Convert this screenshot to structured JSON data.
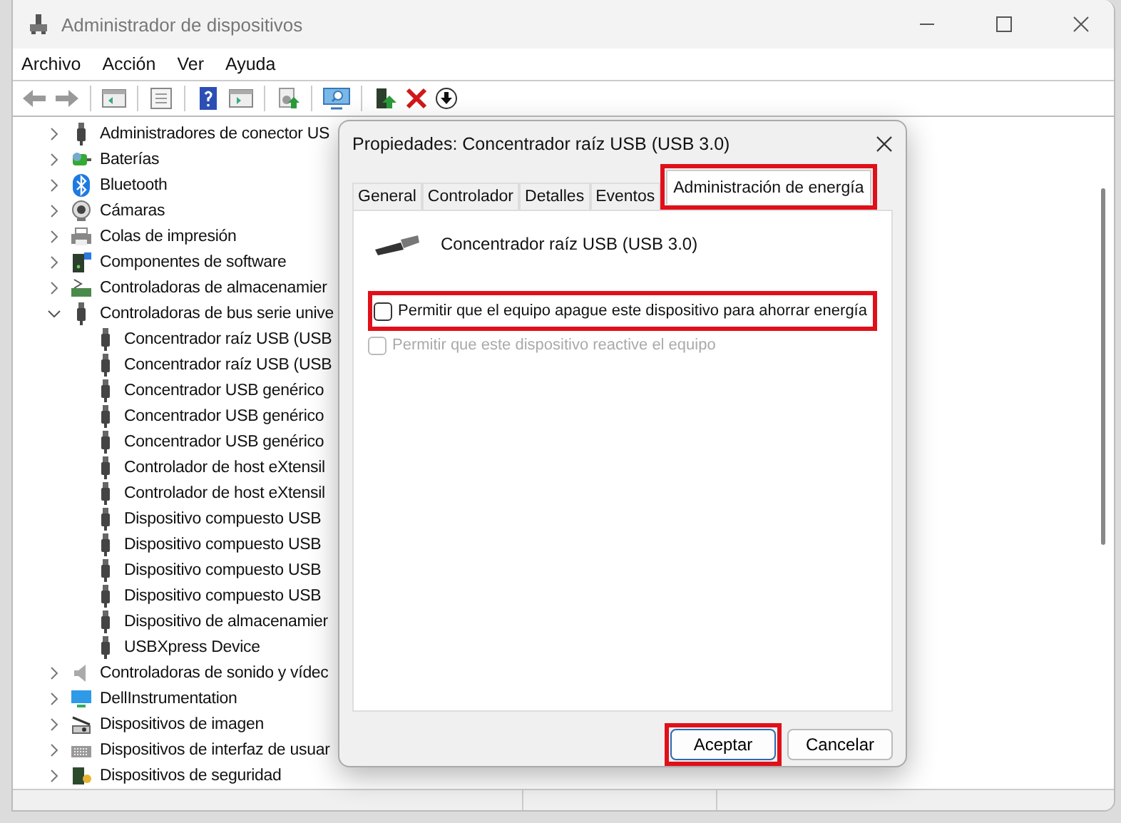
{
  "window": {
    "title": "Administrador de dispositivos"
  },
  "menu": [
    "Archivo",
    "Acción",
    "Ver",
    "Ayuda"
  ],
  "tree": [
    {
      "label": "Administradores de conector US",
      "expanded": false
    },
    {
      "label": "Baterías",
      "expanded": false
    },
    {
      "label": "Bluetooth",
      "expanded": false
    },
    {
      "label": "Cámaras",
      "expanded": false
    },
    {
      "label": "Colas de impresión",
      "expanded": false
    },
    {
      "label": "Componentes de software",
      "expanded": false
    },
    {
      "label": "Controladoras de almacenamier",
      "expanded": false
    },
    {
      "label": "Controladoras de bus serie unive",
      "expanded": true,
      "children": [
        {
          "label": "Concentrador raíz USB (USB"
        },
        {
          "label": "Concentrador raíz USB (USB"
        },
        {
          "label": "Concentrador USB genérico"
        },
        {
          "label": "Concentrador USB genérico"
        },
        {
          "label": "Concentrador USB genérico"
        },
        {
          "label": "Controlador de host eXtensil"
        },
        {
          "label": "Controlador de host eXtensil"
        },
        {
          "label": "Dispositivo compuesto USB"
        },
        {
          "label": "Dispositivo compuesto USB"
        },
        {
          "label": "Dispositivo compuesto USB"
        },
        {
          "label": "Dispositivo compuesto USB"
        },
        {
          "label": "Dispositivo de almacenamier"
        },
        {
          "label": "USBXpress Device"
        }
      ]
    },
    {
      "label": "Controladoras de sonido y vídec",
      "expanded": false
    },
    {
      "label": "DellInstrumentation",
      "expanded": false
    },
    {
      "label": "Dispositivos de imagen",
      "expanded": false
    },
    {
      "label": "Dispositivos de interfaz de usuar",
      "expanded": false
    },
    {
      "label": "Dispositivos de seguridad",
      "expanded": false
    }
  ],
  "dialog": {
    "title": "Propiedades: Concentrador raíz USB (USB 3.0)",
    "tabs": [
      {
        "label": "General",
        "selected": false,
        "highlighted": false
      },
      {
        "label": "Controlador",
        "selected": false,
        "highlighted": false
      },
      {
        "label": "Detalles",
        "selected": false,
        "highlighted": false
      },
      {
        "label": "Eventos",
        "selected": false,
        "highlighted": false
      },
      {
        "label": "Administración de energía",
        "selected": true,
        "highlighted": true
      }
    ],
    "device_name": "Concentrador raíz USB (USB 3.0)",
    "options": [
      {
        "label": "Permitir que el equipo apague este dispositivo para ahorrar energía",
        "checked": false,
        "disabled": false,
        "highlighted": true
      },
      {
        "label": "Permitir que este dispositivo reactive el equipo",
        "checked": false,
        "disabled": true,
        "highlighted": false
      }
    ],
    "buttons": [
      {
        "label": "Aceptar",
        "default": true,
        "highlighted": true
      },
      {
        "label": "Cancelar",
        "default": false,
        "highlighted": false
      }
    ]
  }
}
